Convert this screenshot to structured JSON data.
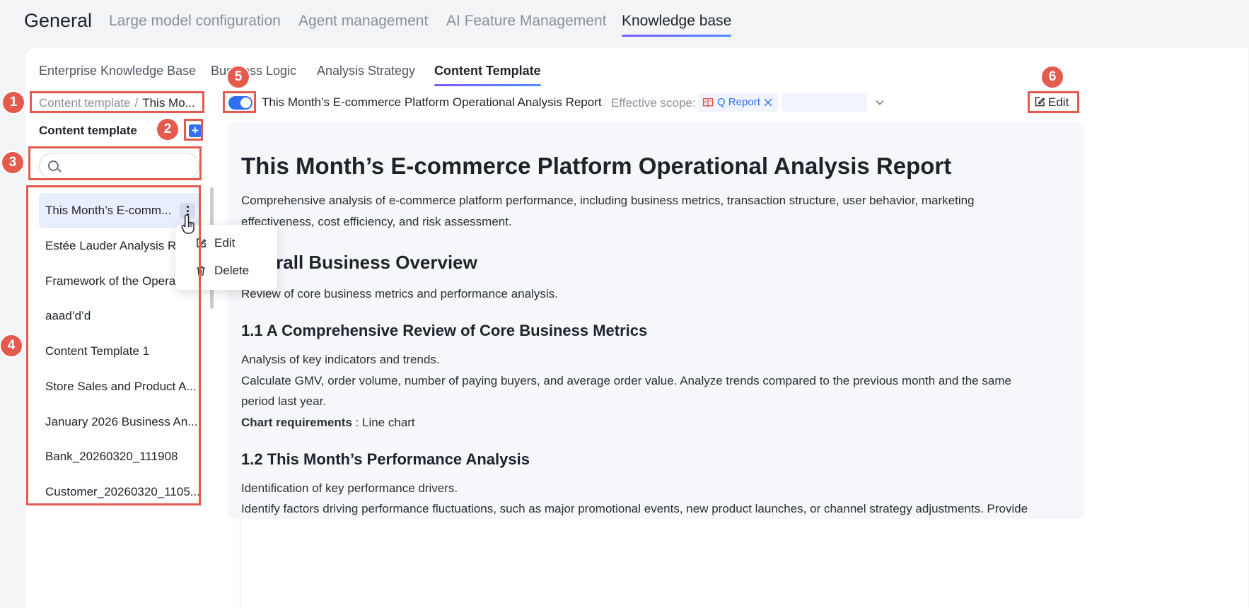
{
  "top_nav": {
    "title": "General",
    "tabs": [
      {
        "label": "Large model configuration"
      },
      {
        "label": "Agent management"
      },
      {
        "label": "AI Feature Management"
      },
      {
        "label": "Knowledge base"
      }
    ],
    "active_tab": "Knowledge base"
  },
  "sub_tabs": [
    {
      "label": "Enterprise Knowledge Base"
    },
    {
      "label": "Business Logic"
    },
    {
      "label": "Analysis Strategy"
    },
    {
      "label": "Content Template"
    }
  ],
  "sub_tabs_active": "Content Template",
  "left_panel": {
    "breadcrumb": {
      "root": "Content template",
      "separator": "/",
      "current": "This Mo..."
    },
    "title": "Content template",
    "add_label": "+",
    "search": {
      "value": "",
      "placeholder": ""
    },
    "items": [
      {
        "label": "This Month’s E-comm..."
      },
      {
        "label": "Estée Lauder Analysis Re"
      },
      {
        "label": "Framework of the Operat"
      },
      {
        "label": "aaad’d’d"
      },
      {
        "label": "Content Template 1"
      },
      {
        "label": "Store Sales and Product A..."
      },
      {
        "label": "January 2026 Business An..."
      },
      {
        "label": "Bank_20260320_111908"
      },
      {
        "label": "Customer_20260320_1105..."
      }
    ],
    "context_menu": {
      "edit": "Edit",
      "delete": "Delete"
    }
  },
  "header": {
    "toggle_on": true,
    "report_title": "This Month’s E-commerce Platform Operational Analysis Report",
    "scope_label": "Effective scope:",
    "scope_tag": "Q Report",
    "edit_label": "Edit"
  },
  "document": {
    "h1": "This Month’s E-commerce Platform Operational Analysis Report",
    "intro_line1": "Comprehensive analysis of e-commerce platform performance, including business metrics, transaction structure, user behavior, marketing",
    "intro_line2": "effectiveness, cost efficiency, and risk assessment.",
    "h2": "Overall Business Overview",
    "h2_desc": "Review of core business metrics and performance analysis.",
    "s11_title": "1.1 A Comprehensive Review of Core Business Metrics",
    "s11_p1": "Analysis of key indicators and trends.",
    "s11_p2_line1": "Calculate GMV, order volume, number of paying buyers, and average order value. Analyze trends compared to the previous month and the same",
    "s11_p2_line2": "period last year.",
    "chart_req_label": "Chart requirements",
    "chart_req_value": " : Line chart",
    "s12_title": "1.2 This Month’s Performance Analysis",
    "s12_p1": "Identification of key performance drivers.",
    "s12_p2": "Identify factors driving performance fluctuations, such as major promotional events, new product launches, or channel strategy adjustments. Provide"
  },
  "annotations": [
    "1",
    "2",
    "3",
    "4",
    "5",
    "6"
  ],
  "colors": {
    "accent": "#2f6ff0",
    "annotation": "#e55a4e",
    "active_item_bg": "#e8eefc"
  }
}
